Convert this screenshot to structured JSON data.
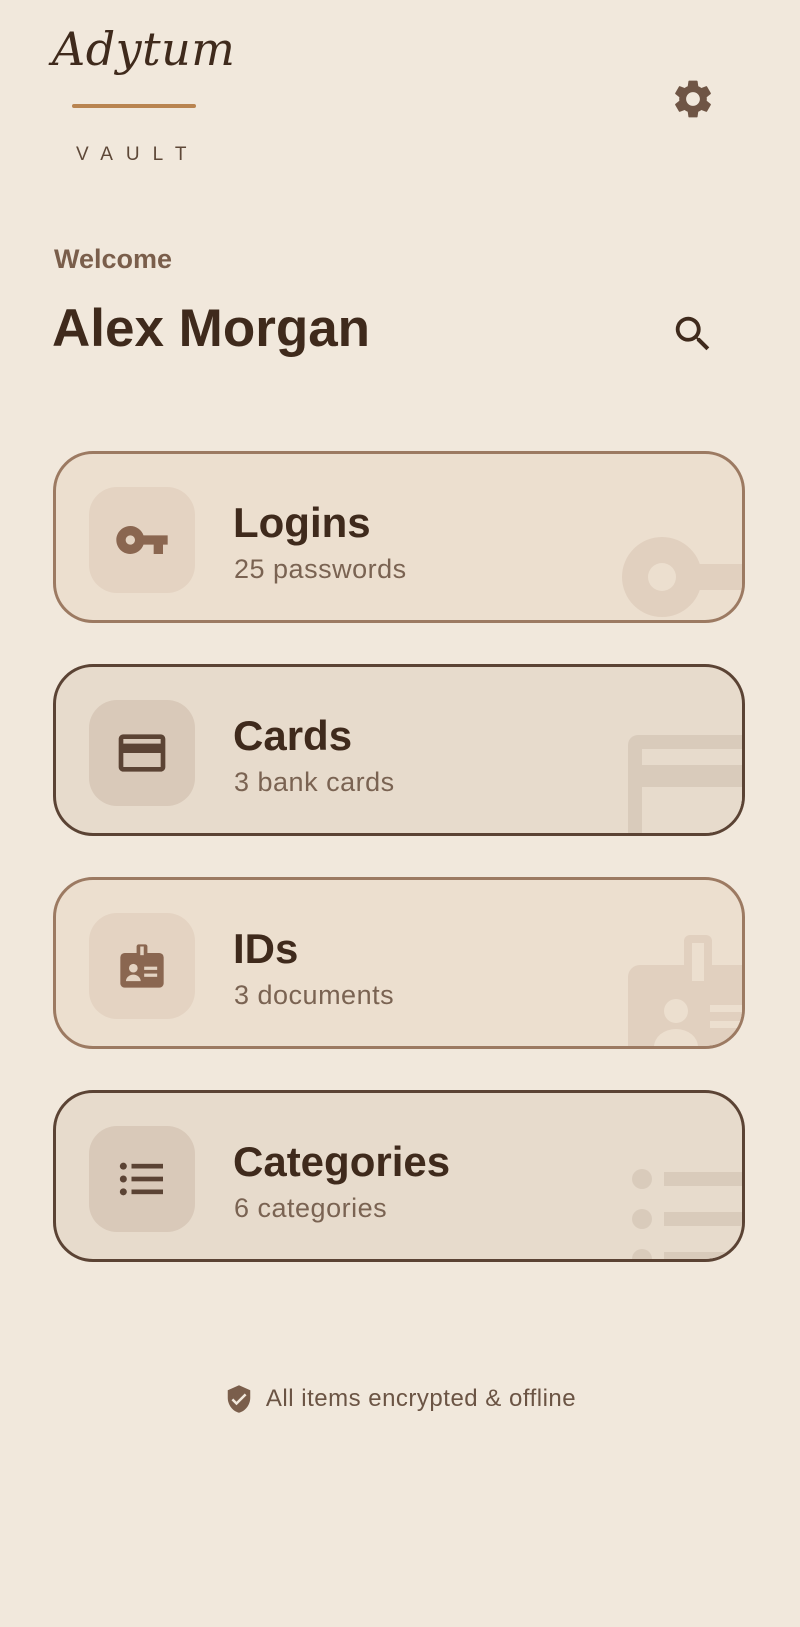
{
  "brand": {
    "name": "Adytum",
    "subtitle": "VAULT"
  },
  "header": {
    "welcome": "Welcome",
    "user_name": "Alex Morgan"
  },
  "icons": {
    "settings": "gear-icon",
    "search": "search-icon",
    "encrypted": "shield-check-icon"
  },
  "colors": {
    "background": "#f1e8dc",
    "accent": "#b98450",
    "text_dark": "#3f2a1c",
    "icon_brown": "#8a6650"
  },
  "cards": [
    {
      "title": "Logins",
      "subtitle": "25 passwords",
      "icon": "key-icon"
    },
    {
      "title": "Cards",
      "subtitle": "3 bank cards",
      "icon": "credit-card-icon"
    },
    {
      "title": "IDs",
      "subtitle": "3 documents",
      "icon": "id-badge-icon"
    },
    {
      "title": "Categories",
      "subtitle": "6 categories",
      "icon": "list-icon"
    }
  ],
  "footer": {
    "text": "All items encrypted & offline"
  }
}
